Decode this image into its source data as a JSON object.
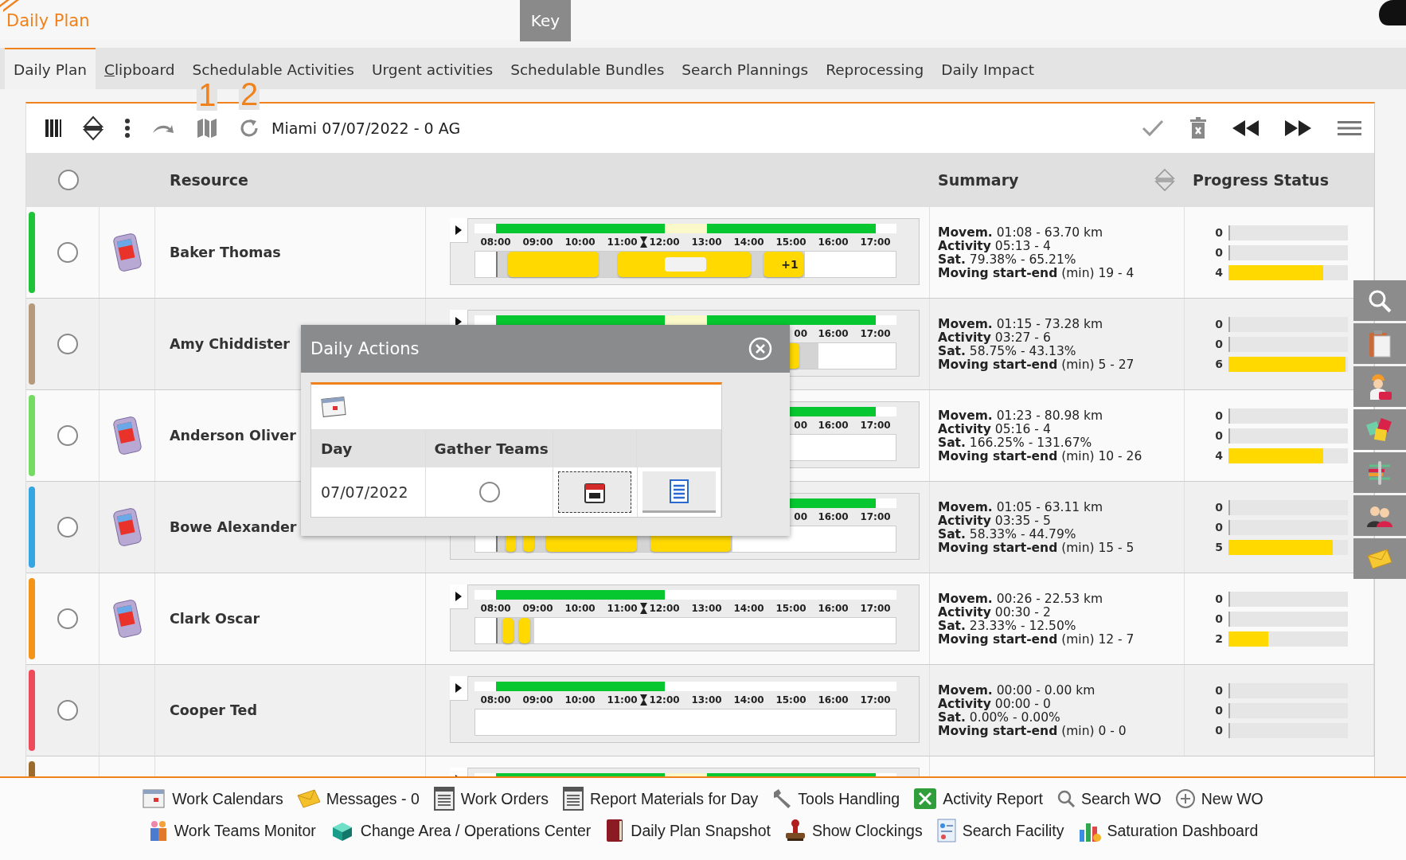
{
  "app_title": "Daily Plan",
  "key_button": "Key",
  "tabs": [
    {
      "label": "Daily Plan",
      "selected": true,
      "underline_first": false
    },
    {
      "label": "Clipboard",
      "selected": false,
      "underline_first": true
    },
    {
      "label": "Schedulable Activities",
      "selected": false,
      "underline_first": false
    },
    {
      "label": "Urgent activities",
      "selected": false,
      "underline_first": false
    },
    {
      "label": "Schedulable Bundles",
      "selected": false,
      "underline_first": false
    },
    {
      "label": "Search Plannings",
      "selected": false,
      "underline_first": false
    },
    {
      "label": "Reprocessing",
      "selected": false,
      "underline_first": false
    },
    {
      "label": "Daily Impact",
      "selected": false,
      "underline_first": false
    }
  ],
  "toolbar": {
    "title": "Miami 07/07/2022 - 0 AG",
    "callouts": [
      "1",
      "2"
    ]
  },
  "table": {
    "columns": [
      "Resource",
      "Summary",
      "Progress Status"
    ],
    "select_all": false,
    "rows": [
      {
        "kind": "full",
        "name": "Baker Thomas",
        "selected": false,
        "device": true,
        "color": "#1ec337",
        "expander": true,
        "now_marker": true,
        "block_label": "+1",
        "hours": [
          "08:00",
          "09:00",
          "10:00",
          "11:00",
          "12:00",
          "13:00",
          "14:00",
          "15:00",
          "16:00",
          "17:00"
        ],
        "summary": [
          "**Movem.** 01:08 - 63.70 km",
          "**Activity** 05:13 - 4",
          "**Sat.** 79.38% - 65.21%",
          "**Moving start-end** (min) 19 - 4"
        ],
        "progress": [
          {
            "count": "0",
            "level": 0
          },
          {
            "count": "0",
            "level": 0
          },
          {
            "count": "4",
            "level": 0.79
          }
        ]
      },
      {
        "kind": "full",
        "name": "Amy Chiddister",
        "selected": false,
        "device": false,
        "color": "#b59a7c",
        "expander": true,
        "hours": [
          "00",
          "16:00",
          "17:00"
        ],
        "summary": [
          "**Movem.** 01:15 - 73.28 km",
          "**Activity** 03:27 - 6",
          "**Sat.** 58.75% - 43.13%",
          "**Moving start-end** (min) 5 - 27"
        ],
        "progress": [
          {
            "count": "0",
            "level": 0
          },
          {
            "count": "0",
            "level": 0
          },
          {
            "count": "6",
            "level": 0.98
          }
        ]
      },
      {
        "kind": "full",
        "name": "Anderson Oliver",
        "selected": false,
        "device": true,
        "color": "#74dc62",
        "expander": false,
        "hours": [
          "00",
          "16:00",
          "17:00"
        ],
        "summary": [
          "**Movem.** 01:23 - 80.98 km",
          "**Activity** 05:16 - 4",
          "**Sat.** 166.25% - 131.67%",
          "**Moving start-end** (min) 10 - 26"
        ],
        "progress": [
          {
            "count": "0",
            "level": 0
          },
          {
            "count": "0",
            "level": 0
          },
          {
            "count": "4",
            "level": 0.79
          }
        ]
      },
      {
        "kind": "full",
        "name": "Bowe Alexander",
        "selected": false,
        "device": true,
        "color": "#36a6e2",
        "expander": false,
        "hours": [
          "00",
          "16:00",
          "17:00"
        ],
        "summary": [
          "**Movem.** 01:05 - 63.11 km",
          "**Activity** 03:35 - 5",
          "**Sat.** 58.33% - 44.79%",
          "**Moving start-end** (min) 15 - 5"
        ],
        "progress": [
          {
            "count": "0",
            "level": 0
          },
          {
            "count": "0",
            "level": 0
          },
          {
            "count": "5",
            "level": 0.87
          }
        ]
      },
      {
        "kind": "full",
        "name": "Clark Oscar",
        "selected": false,
        "device": true,
        "color": "#f39318",
        "expander": true,
        "now_marker": true,
        "hours": [
          "08:00",
          "09:00",
          "10:00",
          "11:00",
          "12:00",
          "13:00",
          "14:00",
          "15:00",
          "16:00",
          "17:00"
        ],
        "summary": [
          "**Movem.** 00:26 - 22.53 km",
          "**Activity** 00:30 - 2",
          "**Sat.** 23.33% - 12.50%",
          "**Moving start-end** (min) 12 - 7"
        ],
        "progress": [
          {
            "count": "0",
            "level": 0
          },
          {
            "count": "0",
            "level": 0
          },
          {
            "count": "2",
            "level": 0.33
          }
        ]
      },
      {
        "kind": "full",
        "name": "Cooper Ted",
        "selected": false,
        "device": false,
        "color": "#ee4b5a",
        "expander": true,
        "now_marker": true,
        "hours": [
          "08:00",
          "09:00",
          "10:00",
          "11:00",
          "12:00",
          "13:00",
          "14:00",
          "15:00",
          "16:00",
          "17:00"
        ],
        "summary": [
          "**Movem.** 00:00 - 0.00 km",
          "**Activity** 00:00 - 0",
          "**Sat.** 0.00% - 0.00%",
          "**Moving start-end** (min) 0 - 0"
        ],
        "progress": [
          {
            "count": "0",
            "level": 0
          },
          {
            "count": "0",
            "level": 0
          },
          {
            "count": "0",
            "level": 0
          }
        ]
      },
      {
        "kind": "cut",
        "color": "#9c6a2c",
        "expander": true
      }
    ]
  },
  "dialog": {
    "title": "Daily Actions",
    "columns": [
      "Day",
      "Gather Teams"
    ],
    "rows": [
      {
        "day": "07/07/2022",
        "gather_teams": false
      }
    ]
  },
  "footer": [
    [
      {
        "label": "Work Calendars"
      },
      {
        "label": "Messages - 0"
      },
      {
        "label": "Work Orders"
      },
      {
        "label": "Report Materials for Day"
      },
      {
        "label": "Tools Handling"
      },
      {
        "label": "Activity Report"
      },
      {
        "label": "Search WO"
      },
      {
        "label": "New WO"
      }
    ],
    [
      {
        "label": "Work Teams Monitor"
      },
      {
        "label": "Change Area / Operations Center"
      },
      {
        "label": "Daily Plan Snapshot"
      },
      {
        "label": "Show Clockings"
      },
      {
        "label": "Search Facility"
      },
      {
        "label": "Saturation Dashboard"
      }
    ]
  ]
}
